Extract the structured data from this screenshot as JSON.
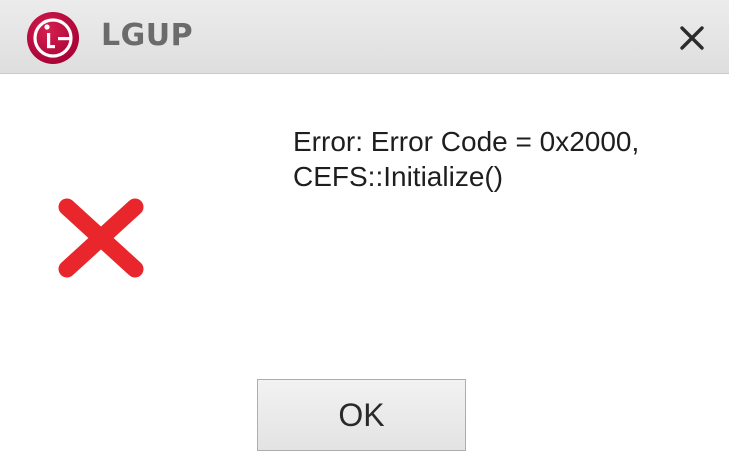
{
  "window": {
    "title": "LGUP"
  },
  "dialog": {
    "message_line1": "Error: Error Code = 0x2000,",
    "message_line2": "CEFS::Initialize()",
    "ok_label": "OK"
  },
  "icons": {
    "app": "lg-logo-icon",
    "close": "close-icon",
    "error": "error-x-icon"
  },
  "colors": {
    "brand": "#a50034",
    "error": "#e8262b",
    "title_text": "#6b6b6b"
  }
}
